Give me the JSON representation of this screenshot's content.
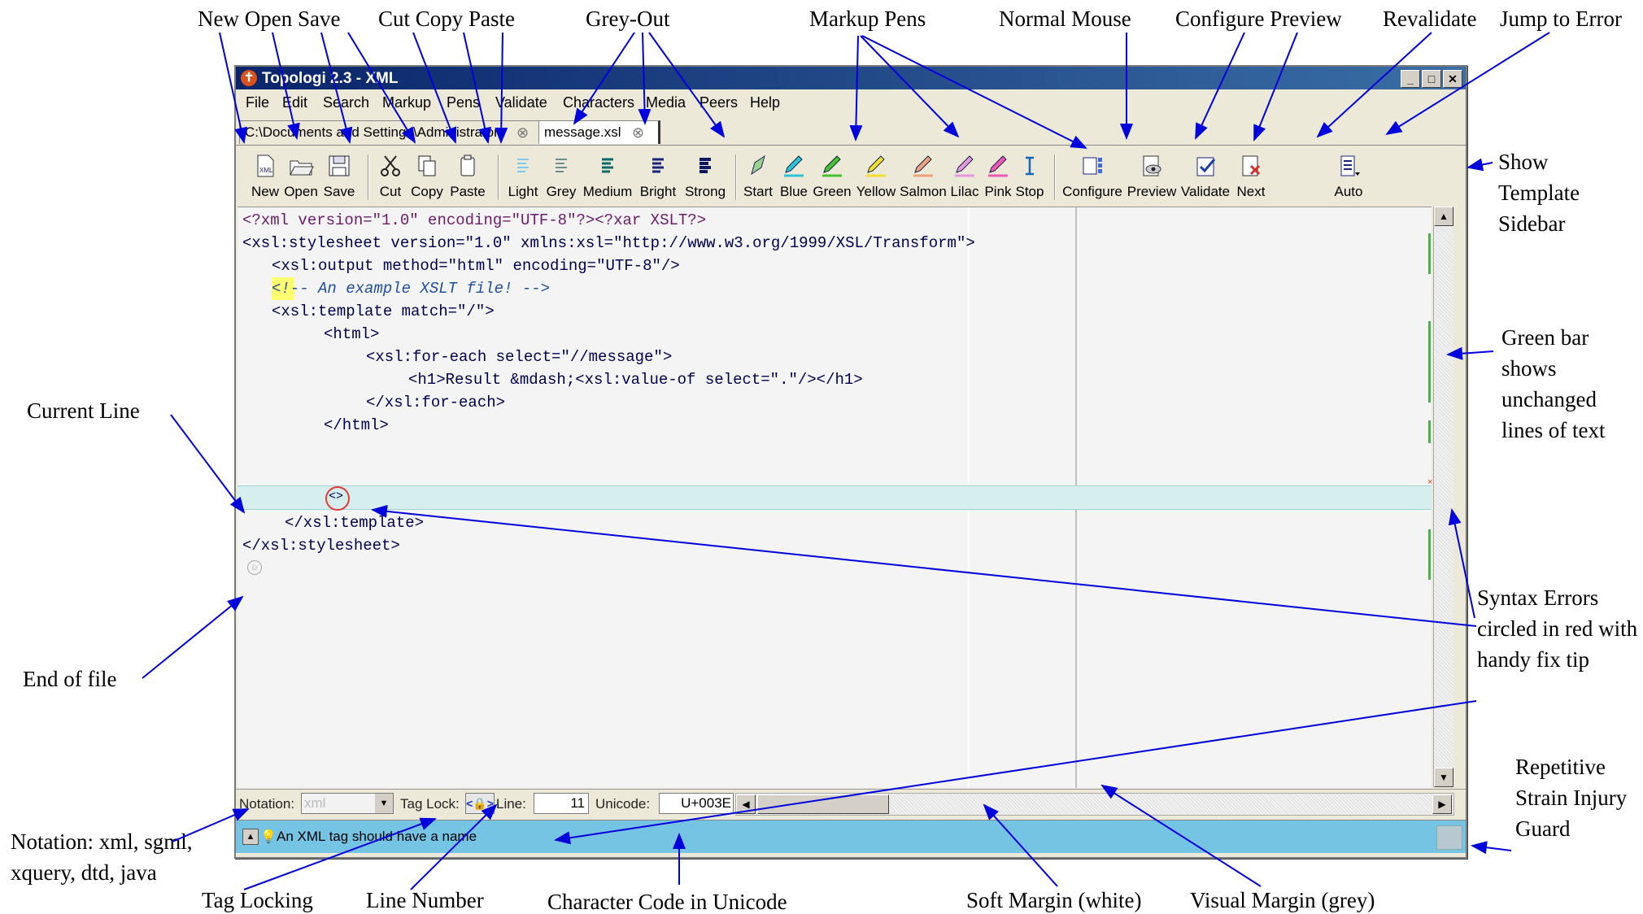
{
  "annotations": {
    "new_open_save": "New Open Save",
    "cut_copy_paste": "Cut Copy Paste",
    "grey_out": "Grey-Out",
    "markup_pens": "Markup Pens",
    "normal_mouse": "Normal Mouse",
    "configure_preview": "Configure Preview",
    "revalidate": "Revalidate",
    "jump_to_error": "Jump to Error",
    "show_template_sidebar": "Show Template Sidebar",
    "green_bar": "Green bar shows unchanged lines of text",
    "current_line": "Current Line",
    "end_of_file": "End of file",
    "syntax_errors": "Syntax Errors circled in red with handy fix tip",
    "rsi_guard": "Repetitive Strain Injury Guard",
    "notation": "Notation: xml, sgml, xquery, dtd, java",
    "tag_locking": "Tag Locking",
    "line_number": "Line Number",
    "character_code": "Character Code in Unicode",
    "soft_margin": "Soft Margin (white)",
    "visual_margin": "Visual Margin (grey)"
  },
  "window": {
    "title": "Topologi 2.3 - XML",
    "minimize": "_",
    "maximize": "□",
    "close": "✕"
  },
  "menu": [
    "File",
    "Edit",
    "Search",
    "Markup",
    "Pens",
    "Validate",
    "Characters",
    "Media",
    "Peers",
    "Help"
  ],
  "tabs": [
    {
      "label": "C:\\Documents and Settings\\Administrator",
      "active": false
    },
    {
      "label": "message.xsl",
      "active": true
    }
  ],
  "toolbar": {
    "new": "New",
    "open": "Open",
    "save": "Save",
    "cut": "Cut",
    "copy": "Copy",
    "paste": "Paste",
    "light": "Light",
    "grey": "Grey",
    "medium": "Medium",
    "bright": "Bright",
    "strong": "Strong",
    "start": "Start",
    "blue": "Blue",
    "green": "Green",
    "yellow": "Yellow",
    "salmon": "Salmon",
    "lilac": "Lilac",
    "pink": "Pink",
    "stop": "Stop",
    "configure": "Configure",
    "preview": "Preview",
    "validate": "Validate",
    "next": "Next",
    "auto": "Auto"
  },
  "code": [
    "<?xml version=\"1.0\" encoding=\"UTF-8\"?><?xar XSLT?>",
    "<xsl:stylesheet version=\"1.0\" xmlns:xsl=\"http://www.w3.org/1999/XSL/Transform\">",
    "<xsl:output method=\"html\" encoding=\"UTF-8\"/>",
    "<!-- An example XSLT file! -->",
    "<xsl:template match=\"/\">",
    "<html>",
    "<xsl:for-each select=\"//message\">",
    "<h1>Result &mdash;<xsl:value-of select=\".\"/></h1>",
    "</xsl:for-each>",
    "</html>",
    "<>",
    "</xsl:template>",
    "</xsl:stylesheet>"
  ],
  "status": {
    "notation_label": "Notation:",
    "notation_value": "xml",
    "tag_lock_label": "Tag Lock:",
    "line_label": "Line:",
    "line_value": "11",
    "unicode_label": "Unicode:",
    "unicode_value": "U+003E"
  },
  "message": "An XML tag should have a name",
  "colors": {
    "title_bar": "#0a246a",
    "message_bar": "#76c4e4",
    "current_line": "#d6eeee",
    "unchanged_bar": "#4caf50",
    "annotation_arrow": "#0000dd",
    "error_circle": "#e53935"
  }
}
